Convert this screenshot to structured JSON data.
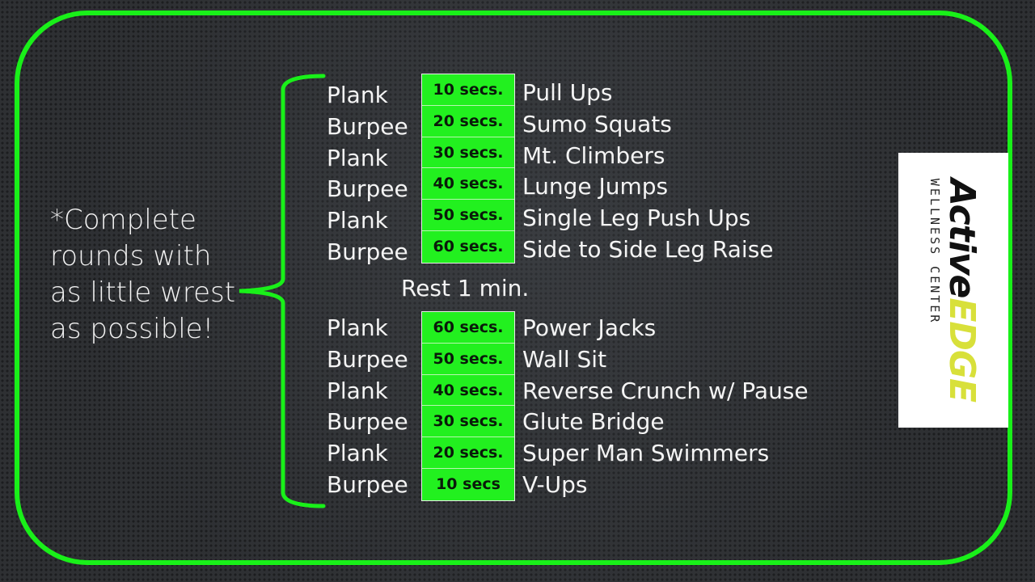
{
  "note": "*Complete rounds with as little wrest as possible!",
  "rest_label": "Rest 1 min.",
  "accent_color": "#19f019",
  "round1": [
    {
      "left": "Plank",
      "time": "10 secs.",
      "exercise": "Pull Ups"
    },
    {
      "left": "Burpee",
      "time": "20 secs.",
      "exercise": "Sumo Squats"
    },
    {
      "left": "Plank",
      "time": "30 secs.",
      "exercise": "Mt. Climbers"
    },
    {
      "left": "Burpee",
      "time": "40 secs.",
      "exercise": "Lunge Jumps"
    },
    {
      "left": "Plank",
      "time": "50 secs.",
      "exercise": "Single Leg Push Ups"
    },
    {
      "left": "Burpee",
      "time": "60 secs.",
      "exercise": "Side to Side Leg Raise"
    }
  ],
  "round2": [
    {
      "left": "Plank",
      "time": "60 secs.",
      "exercise": "Power Jacks"
    },
    {
      "left": "Burpee",
      "time": "50 secs.",
      "exercise": "Wall Sit"
    },
    {
      "left": "Plank",
      "time": "40 secs.",
      "exercise": "Reverse Crunch w/ Pause"
    },
    {
      "left": "Burpee",
      "time": "30 secs.",
      "exercise": "Glute Bridge"
    },
    {
      "left": "Plank",
      "time": "20 secs.",
      "exercise": "Super Man Swimmers"
    },
    {
      "left": "Burpee",
      "time": "10 secs",
      "exercise": "V-Ups"
    }
  ],
  "logo": {
    "brand_part1": "Active",
    "brand_part2": "EDGE",
    "subtitle": "WELLNESS CENTER"
  }
}
